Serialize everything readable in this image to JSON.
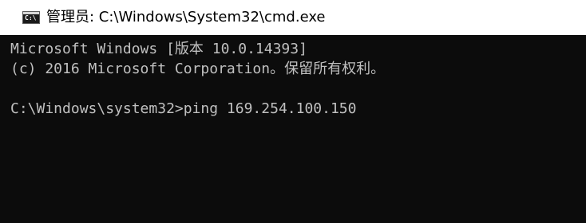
{
  "window": {
    "title": "管理员: C:\\Windows\\System32\\cmd.exe",
    "icon": "cmd-console-icon",
    "icon_glyph": "C:\\"
  },
  "console": {
    "lines": [
      "Microsoft Windows [版本 10.0.14393]",
      "(c) 2016 Microsoft Corporation。保留所有权利。",
      "",
      "C:\\Windows\\system32>ping 169.254.100.150"
    ]
  },
  "colors": {
    "console_background": "#0c0c0c",
    "console_text": "#c0c0c0",
    "titlebar_background": "#ffffff"
  }
}
